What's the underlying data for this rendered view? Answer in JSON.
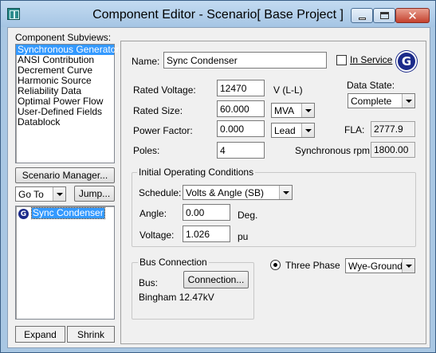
{
  "window": {
    "title": "Component Editor  - Scenario[ Base Project ]"
  },
  "left": {
    "subviews_label": "Component Subviews:",
    "subviews": [
      "Synchronous Generator",
      "ANSI Contribution",
      "Decrement Curve",
      "Harmonic Source",
      "Reliability Data",
      "Optimal Power Flow",
      "User-Defined Fields",
      "Datablock"
    ],
    "scenario_manager_label": "Scenario Manager...",
    "goto_value": "Go To",
    "jump_label": "Jump...",
    "tree_item_label": "Sync Condenser",
    "expand_label": "Expand",
    "shrink_label": "Shrink"
  },
  "form": {
    "name_label": "Name:",
    "name_value": "Sync Condenser",
    "in_service_label": "In Service",
    "icon_letter": "G",
    "rated_voltage_label": "Rated Voltage:",
    "rated_voltage_value": "12470",
    "rated_voltage_unit": "V (L-L)",
    "rated_size_label": "Rated Size:",
    "rated_size_value": "60.000",
    "rated_size_unit": "MVA",
    "power_factor_label": "Power Factor:",
    "power_factor_value": "0.000",
    "power_factor_mode": "Lead",
    "poles_label": "Poles:",
    "poles_value": "4",
    "data_state_label": "Data State:",
    "data_state_value": "Complete",
    "fla_label": "FLA:",
    "fla_value": "2777.9",
    "sync_rpm_label": "Synchronous rpm:",
    "sync_rpm_value": "1800.00"
  },
  "initial_conditions": {
    "title": "Initial Operating Conditions",
    "schedule_label": "Schedule:",
    "schedule_value": "Volts & Angle (SB)",
    "angle_label": "Angle:",
    "angle_value": "0.00",
    "angle_unit": "Deg.",
    "voltage_label": "Voltage:",
    "voltage_value": "1.026",
    "voltage_unit": "pu"
  },
  "bus_connection": {
    "title": "Bus Connection",
    "bus_label": "Bus:",
    "connection_button": "Connection...",
    "bus_name": "Bingham 12.47kV"
  },
  "phase": {
    "three_phase_label": "Three Phase",
    "connection_type": "Wye-Ground"
  }
}
